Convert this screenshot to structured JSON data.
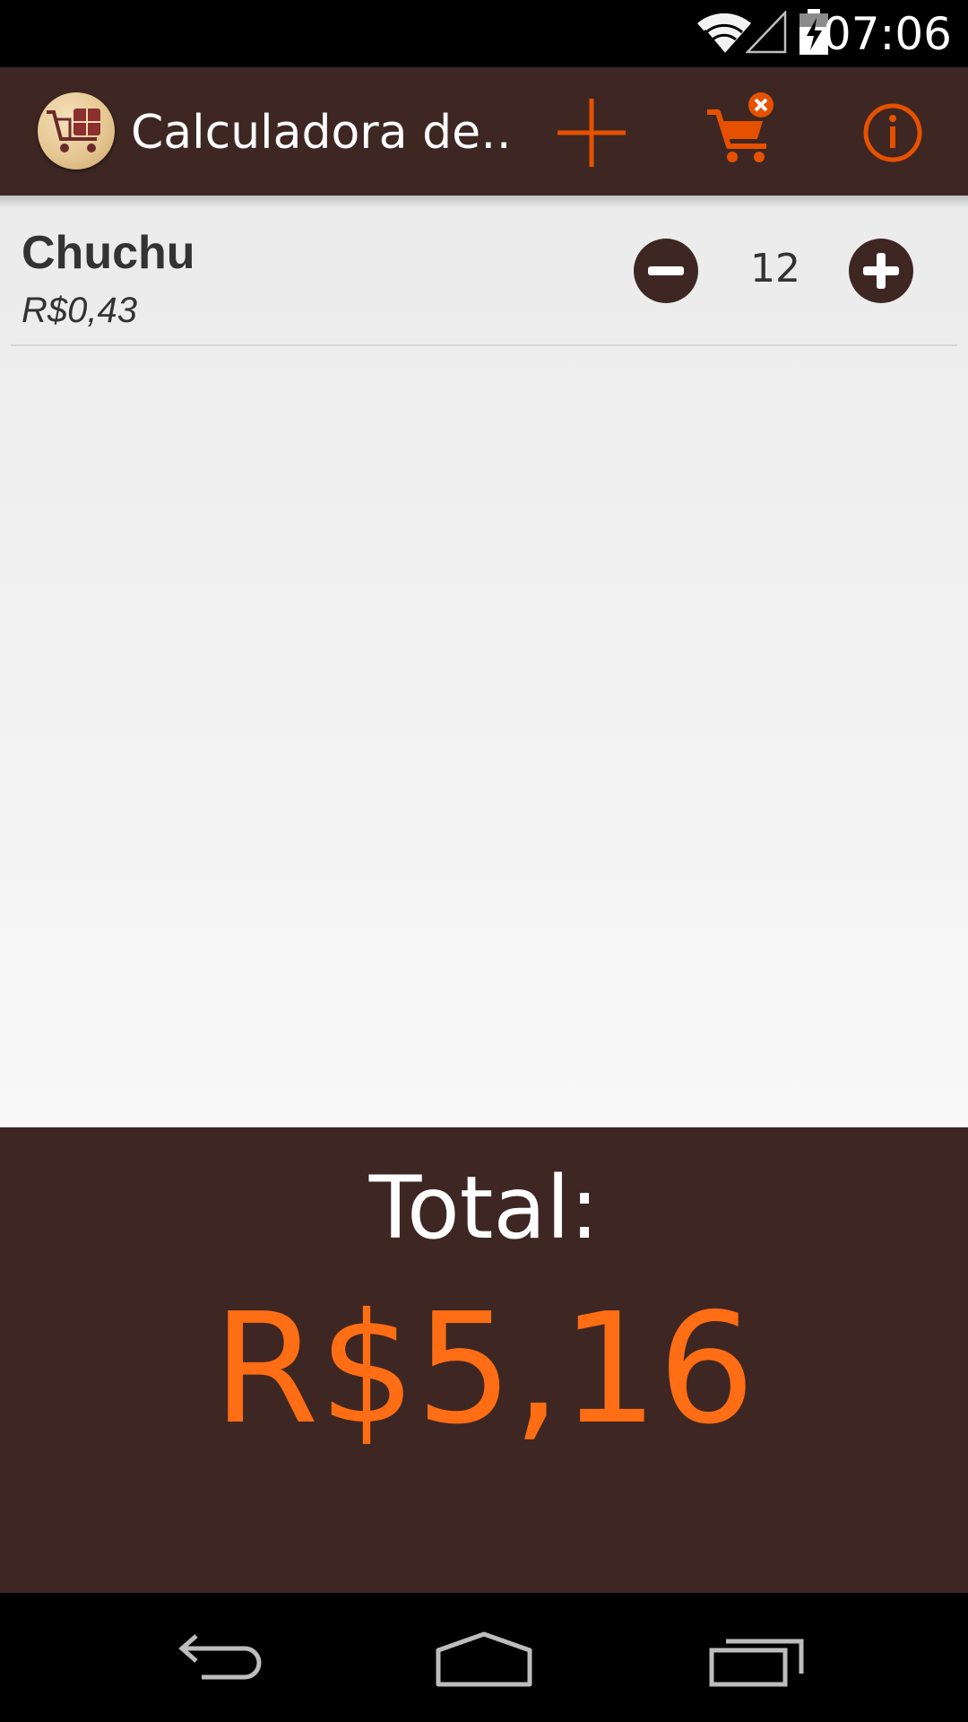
{
  "status_bar": {
    "time": "07:06",
    "icons": [
      "wifi-icon",
      "signal-icon",
      "battery-charging-icon"
    ]
  },
  "app_bar": {
    "title": "Calculadora de…",
    "logo_icon": "cart-calculator-icon",
    "actions": [
      "add-icon",
      "clear-cart-icon",
      "info-icon"
    ],
    "accent_color": "#e65100",
    "background_color": "#3e2723"
  },
  "items": [
    {
      "name": "Chuchu",
      "price": "R$0,43",
      "quantity": "12"
    }
  ],
  "total": {
    "label": "Total:",
    "value": "R$5,16",
    "value_color": "#ff6d14"
  },
  "nav_bar": {
    "buttons": [
      "back-icon",
      "home-icon",
      "recents-icon"
    ]
  }
}
